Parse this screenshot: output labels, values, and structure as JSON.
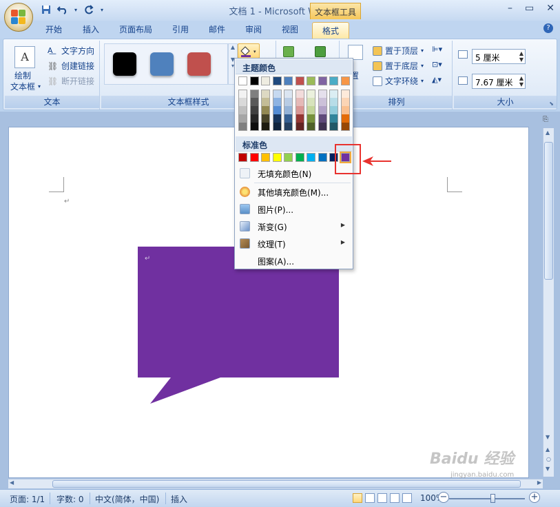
{
  "window": {
    "title": "文档 1 - Microsoft Word",
    "context_tab_title": "文本框工具"
  },
  "tabs": [
    "开始",
    "插入",
    "页面布局",
    "引用",
    "邮件",
    "审阅",
    "视图",
    "格式"
  ],
  "active_tab": "格式",
  "ribbon": {
    "text_group": {
      "label": "文本",
      "draw_textbox": "绘制",
      "draw_textbox2": "文本框",
      "text_direction": "文字方向",
      "create_link": "创建链接",
      "break_link": "断开链接"
    },
    "styles_group": {
      "label": "文本框样式",
      "swatches": [
        "#000000",
        "#4f81bd",
        "#c0504d"
      ]
    },
    "arrange_group": {
      "label": "排列",
      "bring_front": "置于顶层",
      "send_back": "置于底层",
      "text_wrap": "文字环绕",
      "position_frag": "置"
    },
    "size_group": {
      "label": "大小",
      "height": "5 厘米",
      "width": "7.67 厘米"
    }
  },
  "menu": {
    "theme_colors_header": "主题颜色",
    "standard_colors_header": "标准色",
    "theme_top_row": [
      "#ffffff",
      "#000000",
      "#eeece1",
      "#1f497d",
      "#4f81bd",
      "#c0504d",
      "#9bbb59",
      "#8064a2",
      "#4bacc6",
      "#f79646"
    ],
    "theme_columns": [
      [
        "#f2f2f2",
        "#d9d9d9",
        "#bfbfbf",
        "#a6a6a6",
        "#808080"
      ],
      [
        "#7f7f7f",
        "#595959",
        "#404040",
        "#262626",
        "#0d0d0d"
      ],
      [
        "#ddd9c3",
        "#c4bd97",
        "#938953",
        "#494429",
        "#1d1b10"
      ],
      [
        "#c6d9f0",
        "#8db3e2",
        "#548dd4",
        "#17365d",
        "#0f243e"
      ],
      [
        "#dbe5f1",
        "#b8cce4",
        "#95b3d7",
        "#366092",
        "#244061"
      ],
      [
        "#f2dcdb",
        "#e5b9b7",
        "#d99694",
        "#953734",
        "#632423"
      ],
      [
        "#ebf1dd",
        "#d7e3bc",
        "#c3d69b",
        "#76923c",
        "#4f6128"
      ],
      [
        "#e5e0ec",
        "#ccc1d9",
        "#b2a2c7",
        "#5f497a",
        "#3f3151"
      ],
      [
        "#dbeef3",
        "#b7dde8",
        "#92cddc",
        "#31859b",
        "#205867"
      ],
      [
        "#fdeada",
        "#fbd5b5",
        "#fac08f",
        "#e36c09",
        "#974806"
      ]
    ],
    "standard_colors": [
      "#c00000",
      "#ff0000",
      "#ffc000",
      "#ffff00",
      "#92d050",
      "#00b050",
      "#00b0f0",
      "#0070c0",
      "#002060",
      "#7030a0"
    ],
    "items": {
      "no_fill": "无填充颜色(N)",
      "more_colors": "其他填充颜色(M)...",
      "picture": "图片(P)...",
      "gradient": "渐变(G)",
      "texture": "纹理(T)",
      "pattern": "图案(A)..."
    }
  },
  "document": {
    "callout_color": "#7030a0"
  },
  "status": {
    "page": "页面: 1/1",
    "words": "字数: 0",
    "language": "中文(简体，中国)",
    "mode": "插入",
    "zoom": "100%"
  },
  "watermark": {
    "text": "Baidu 经验",
    "sub": "jingyan.baidu.com"
  }
}
